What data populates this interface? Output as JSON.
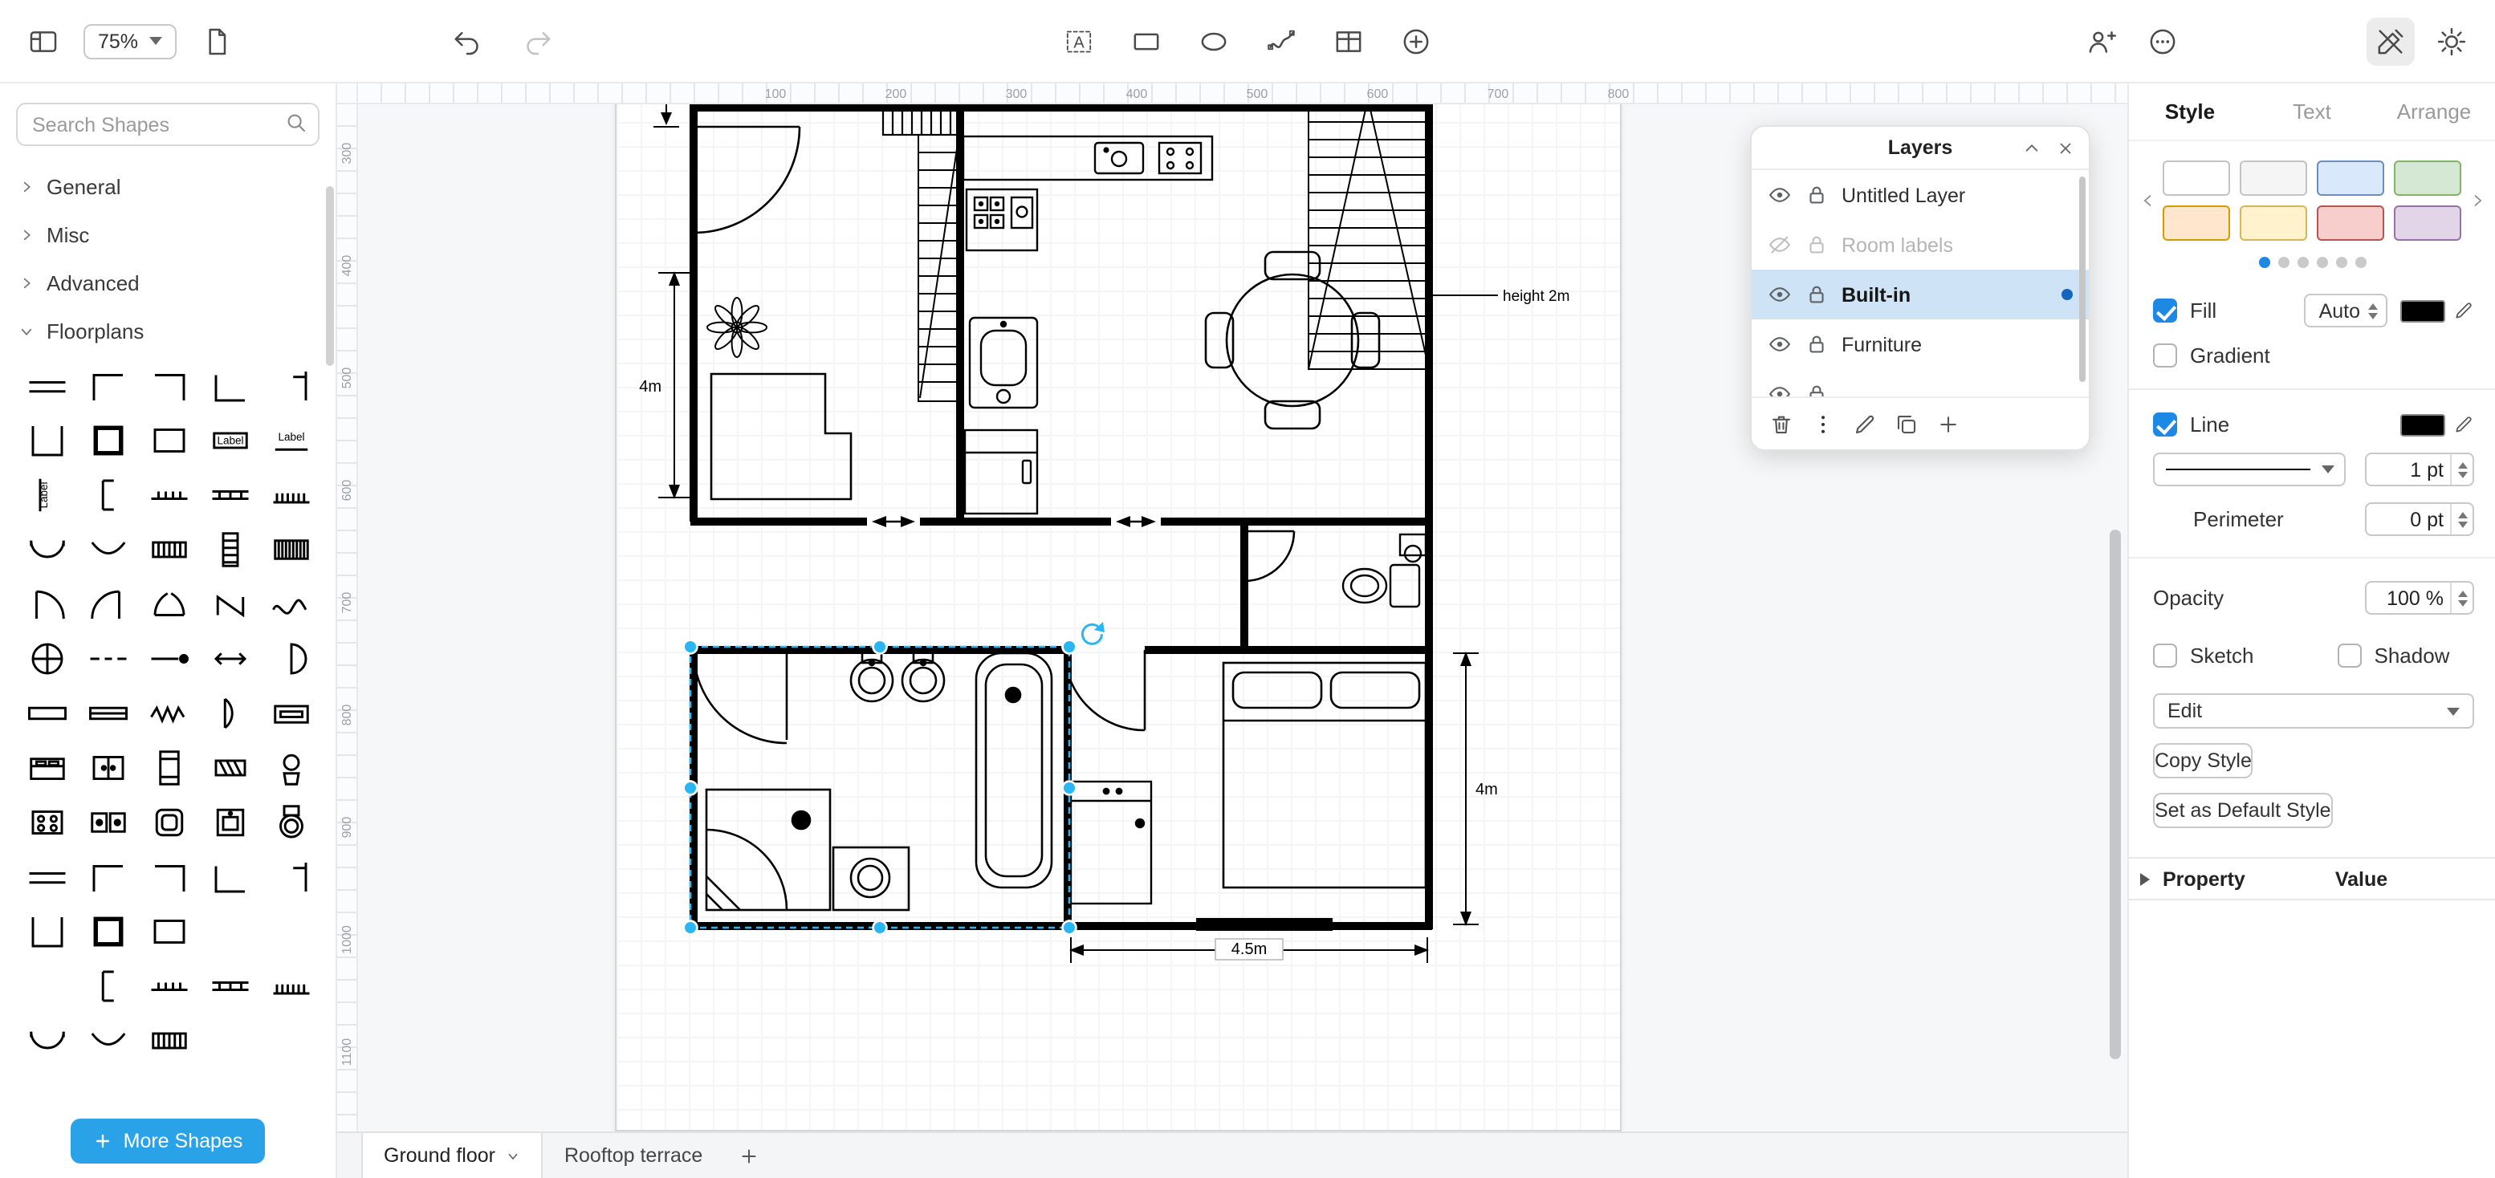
{
  "colors": {
    "accent_blue": "#1e88e5",
    "selection_cyan": "#29b6f2",
    "more_shapes_button": "#2aa2e8",
    "selected_layer_bg": "#cfe3f6",
    "layer_dot": "#1565c0"
  },
  "toolbar": {
    "zoom_value": "75%"
  },
  "shapes_panel": {
    "search_placeholder": "Search Shapes",
    "thumbnail_label": "Label",
    "sections": [
      {
        "label": "General",
        "expanded": false
      },
      {
        "label": "Misc",
        "expanded": false
      },
      {
        "label": "Advanced",
        "expanded": false
      },
      {
        "label": "Floorplans",
        "expanded": true
      }
    ],
    "more_shapes_label": "More Shapes"
  },
  "canvas": {
    "ruler_h_labels": [
      "100",
      "200",
      "300",
      "400",
      "500",
      "600",
      "700",
      "800"
    ],
    "ruler_v_labels": [
      "300",
      "400",
      "500",
      "600",
      "700",
      "800",
      "900",
      "1000",
      "1100"
    ],
    "annotations": {
      "height_label": "height 2m",
      "dim_left": "4m",
      "dim_right": "4m",
      "dim_bottom": "4.5m"
    }
  },
  "layers_panel": {
    "title": "Layers",
    "layers": [
      {
        "name": "Untitled Layer",
        "visible": true,
        "locked": true,
        "selected": false,
        "dimmed": false
      },
      {
        "name": "Room labels",
        "visible": false,
        "locked": true,
        "selected": false,
        "dimmed": true
      },
      {
        "name": "Built-in",
        "visible": true,
        "locked": true,
        "selected": true,
        "dimmed": false
      },
      {
        "name": "Furniture",
        "visible": true,
        "locked": true,
        "selected": false,
        "dimmed": false
      }
    ]
  },
  "format_panel": {
    "tabs": [
      {
        "label": "Style",
        "active": true
      },
      {
        "label": "Text",
        "active": false
      },
      {
        "label": "Arrange",
        "active": false
      }
    ],
    "swatches": [
      {
        "fill": "#ffffff",
        "stroke": "#c3c3c3"
      },
      {
        "fill": "#f5f5f5",
        "stroke": "#c3c3c3"
      },
      {
        "fill": "#dae8fc",
        "stroke": "#6c8ebf"
      },
      {
        "fill": "#d5e8d4",
        "stroke": "#82b366"
      },
      {
        "fill": "#ffe6cc",
        "stroke": "#d79b00"
      },
      {
        "fill": "#fff2cc",
        "stroke": "#d6b656"
      },
      {
        "fill": "#f8cecc",
        "stroke": "#b85450"
      },
      {
        "fill": "#e1d5e7",
        "stroke": "#9673a6"
      }
    ],
    "swatch_pages": 6,
    "swatch_page_active": 0,
    "fill": {
      "label": "Fill",
      "checked": true,
      "mode": "Auto"
    },
    "gradient": {
      "label": "Gradient",
      "checked": false
    },
    "line": {
      "label": "Line",
      "checked": true,
      "width": "1 pt"
    },
    "perimeter": {
      "label": "Perimeter",
      "value": "0 pt"
    },
    "opacity": {
      "label": "Opacity",
      "value": "100 %"
    },
    "sketch": {
      "label": "Sketch",
      "checked": false
    },
    "shadow": {
      "label": "Shadow",
      "checked": false
    },
    "edit_label": "Edit",
    "copy_style_label": "Copy Style",
    "set_default_label": "Set as Default Style",
    "property_header": "Property",
    "value_header": "Value"
  },
  "page_tabs": {
    "tabs": [
      {
        "label": "Ground floor",
        "active": true
      },
      {
        "label": "Rooftop terrace",
        "active": false
      }
    ]
  }
}
